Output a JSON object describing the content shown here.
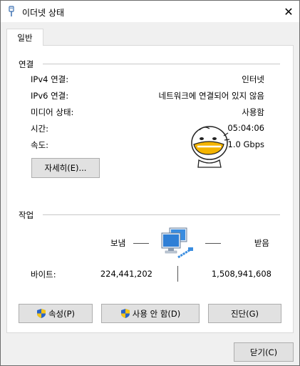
{
  "window": {
    "title": "이더넷 상태",
    "close_glyph": "✕"
  },
  "tabs": [
    {
      "label": "일반"
    }
  ],
  "connection": {
    "title": "연결",
    "rows": [
      {
        "label": "IPv4 연결:",
        "value": "인터넷"
      },
      {
        "label": "IPv6 연결:",
        "value": "네트워크에 연결되어 있지 않음"
      },
      {
        "label": "미디어 상태:",
        "value": "사용함"
      },
      {
        "label": "시간:",
        "value": "05:04:06"
      },
      {
        "label": "속도:",
        "value": "1.0 Gbps"
      }
    ],
    "details_button": "자세히(E)..."
  },
  "activity": {
    "title": "작업",
    "sent_label": "보냄",
    "received_label": "받음",
    "bytes_label": "바이트:",
    "bytes_sent": "224,441,202",
    "bytes_received": "1,508,941,608"
  },
  "buttons": {
    "properties": "속성(P)",
    "disable": "사용 안 함(D)",
    "diagnose": "진단(G)",
    "close": "닫기(C)"
  },
  "icons": {
    "title": "ethernet-cable-icon",
    "sticker": "cartoon-character-sticker",
    "network": "network-computers-icon",
    "shield": "uac-shield-icon"
  },
  "colors": {
    "accent_shield_blue": "#2a64c8",
    "accent_shield_yellow": "#f5c518",
    "sticker_yellow": "#f4b400"
  }
}
